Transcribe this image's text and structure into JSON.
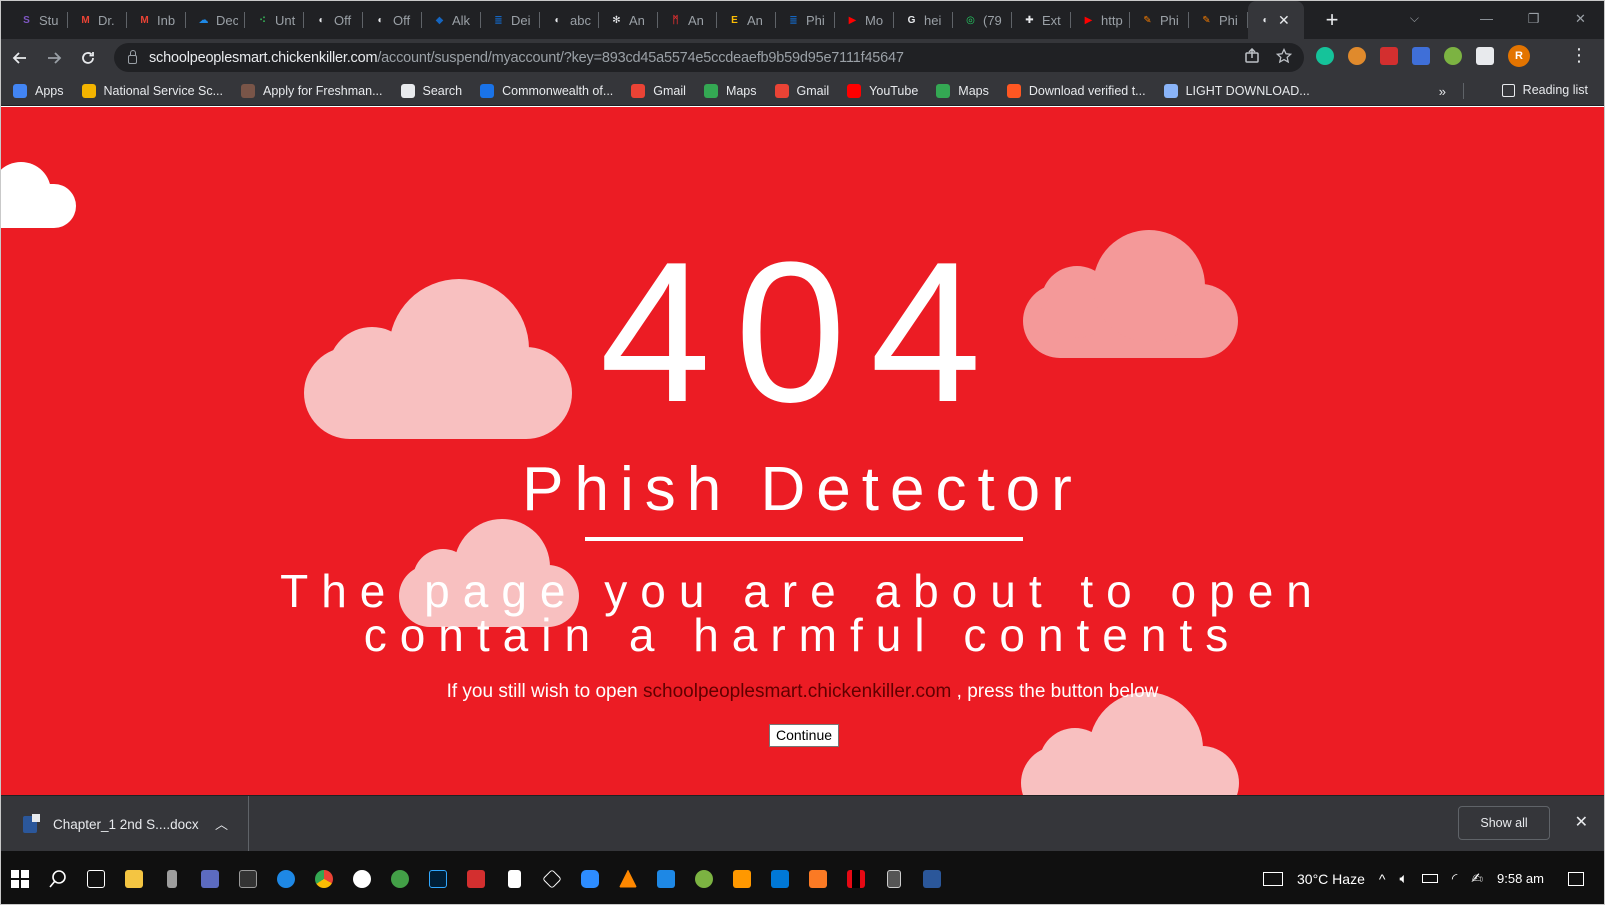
{
  "browser": {
    "tabs": [
      {
        "title": "Stu",
        "color": "#7e57c2",
        "glyph": "S"
      },
      {
        "title": "Dr.",
        "color": "#ea4335",
        "glyph": "M"
      },
      {
        "title": "Inb",
        "color": "#ea4335",
        "glyph": "M"
      },
      {
        "title": "Dec",
        "color": "#1e88e5",
        "glyph": "☁"
      },
      {
        "title": "Unt",
        "color": "#34a853",
        "glyph": "⁖"
      },
      {
        "title": "Off",
        "color": "#e8eaed",
        "glyph": "◐"
      },
      {
        "title": "Off",
        "color": "#e8eaed",
        "glyph": "◐"
      },
      {
        "title": "Alk",
        "color": "#1565c0",
        "glyph": "◆"
      },
      {
        "title": "Dei",
        "color": "#1565c0",
        "glyph": "≣"
      },
      {
        "title": "abc",
        "color": "#e8eaed",
        "glyph": "◐"
      },
      {
        "title": "An",
        "color": "#e8eaed",
        "glyph": "✻"
      },
      {
        "title": "An",
        "color": "#d32f2f",
        "glyph": "ᛗ"
      },
      {
        "title": "An",
        "color": "#fbbc04",
        "glyph": "E"
      },
      {
        "title": "Phi",
        "color": "#1565c0",
        "glyph": "≣"
      },
      {
        "title": "Mo",
        "color": "#ff0000",
        "glyph": "▶"
      },
      {
        "title": "hei",
        "color": "#e8eaed",
        "glyph": "G"
      },
      {
        "title": "(79",
        "color": "#25d366",
        "glyph": "◎"
      },
      {
        "title": "Ext",
        "color": "#e8eaed",
        "glyph": "✚"
      },
      {
        "title": "http",
        "color": "#ff0000",
        "glyph": "▶"
      },
      {
        "title": "Phi",
        "color": "#f57c00",
        "glyph": "✎"
      },
      {
        "title": "Phi",
        "color": "#f57c00",
        "glyph": "✎"
      }
    ],
    "active_tab_close": "✕",
    "new_tab": "+",
    "window_controls": [
      "—",
      "❐",
      "✕"
    ],
    "tab_search": "⌵",
    "url_host": "schoolpeoplesmart.chickenkiller.com",
    "url_path": "/account/suspend/myaccount/?key=893cd45a5574e5ccdeaefb9b59d95e7111f45647",
    "extension_avatar": "R",
    "bookmarks": [
      {
        "label": "Apps",
        "color": "#4285f4"
      },
      {
        "label": "National Service Sc...",
        "color": "#f4b400"
      },
      {
        "label": "Apply for Freshman...",
        "color": "#795548"
      },
      {
        "label": "Search",
        "color": "#e8eaed"
      },
      {
        "label": "Commonwealth of...",
        "color": "#1a73e8"
      },
      {
        "label": "Gmail",
        "color": "#ea4335"
      },
      {
        "label": "Maps",
        "color": "#34a853"
      },
      {
        "label": "Gmail",
        "color": "#ea4335"
      },
      {
        "label": "YouTube",
        "color": "#ff0000"
      },
      {
        "label": "Maps",
        "color": "#34a853"
      },
      {
        "label": "Download verified t...",
        "color": "#ff5722"
      },
      {
        "label": "LIGHT DOWNLOAD...",
        "color": "#8ab4f8"
      }
    ],
    "bookmarks_more": "»",
    "reading_list": "Reading list"
  },
  "page": {
    "background": "#ec1c24",
    "code": "404",
    "title": "Phish Detector",
    "warning_line1": "The page you are about to open",
    "warning_line2": "contain a harmful contents",
    "still_prefix": "If you still wish to open",
    "still_domain": "schoolpeoplesmart.chickenkiller.com",
    "still_suffix": ", press the button below",
    "continue_label": "Continue"
  },
  "downloads": {
    "file_name": "Chapter_1 2nd S....docx",
    "show_all": "Show all",
    "close": "✕"
  },
  "taskbar": {
    "weather": "30°C Haze",
    "time": "9:58 am"
  }
}
